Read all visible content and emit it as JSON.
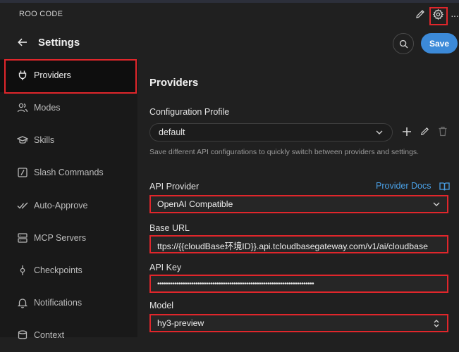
{
  "app": {
    "title": "ROO CODE"
  },
  "header": {
    "title": "Settings",
    "save_label": "Save"
  },
  "sidebar": {
    "items": [
      {
        "label": "Providers",
        "icon": "plug-icon",
        "active": true
      },
      {
        "label": "Modes",
        "icon": "users-icon"
      },
      {
        "label": "Skills",
        "icon": "graduation-cap-icon"
      },
      {
        "label": "Slash Commands",
        "icon": "slash-square-icon"
      },
      {
        "label": "Auto-Approve",
        "icon": "check-double-icon"
      },
      {
        "label": "MCP Servers",
        "icon": "server-icon"
      },
      {
        "label": "Checkpoints",
        "icon": "git-commit-icon"
      },
      {
        "label": "Notifications",
        "icon": "bell-icon"
      },
      {
        "label": "Context",
        "icon": "database-icon"
      }
    ]
  },
  "main": {
    "heading": "Providers",
    "profile": {
      "label": "Configuration Profile",
      "value": "default",
      "help": "Save different API configurations to quickly switch between providers and settings."
    },
    "api_provider": {
      "label": "API Provider",
      "value": "OpenAI Compatible",
      "docs_link": "Provider Docs"
    },
    "base_url": {
      "label": "Base URL",
      "value": "ttps://{{cloudBase环境ID}}.api.tcloudbasegateway.com/v1/ai/cloudbase"
    },
    "api_key": {
      "label": "API Key",
      "value": "••••••••••••••••••••••••••••••••••••••••••••••••••••••••••••••••••••••••••"
    },
    "model": {
      "label": "Model",
      "value": "hy3-preview"
    }
  },
  "colors": {
    "accent": "#3c8ad8",
    "highlight_border": "#e0262b",
    "link": "#4aa0e6"
  }
}
